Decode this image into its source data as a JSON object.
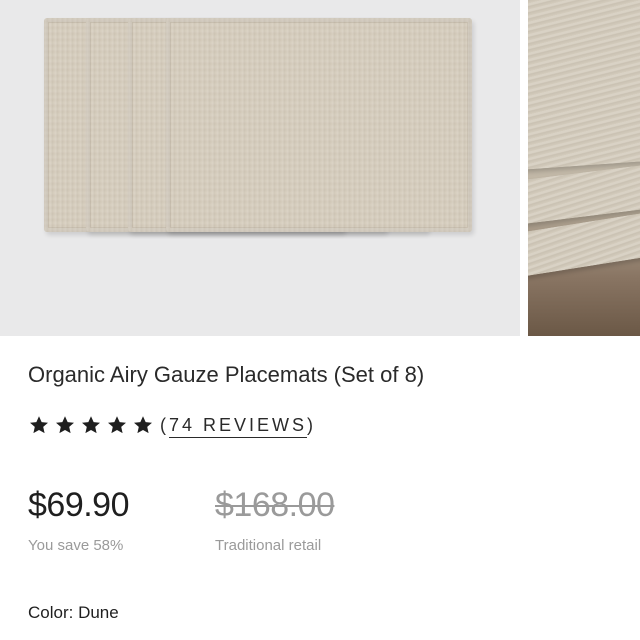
{
  "product": {
    "title": "Organic Airy Gauze Placemats (Set of 8)",
    "rating_stars": 5,
    "reviews_open": "(",
    "reviews_link": "74 REVIEWS",
    "reviews_close": ")",
    "price": "$69.90",
    "original_price": "$168.00",
    "save_note": "You save 58%",
    "retail_note": "Traditional retail",
    "color_label": "Color: Dune"
  },
  "colors": {
    "fabric": "#d6cdbd",
    "gallery_bg": "#e9e9ea",
    "muted_text": "#9a9a9a"
  }
}
